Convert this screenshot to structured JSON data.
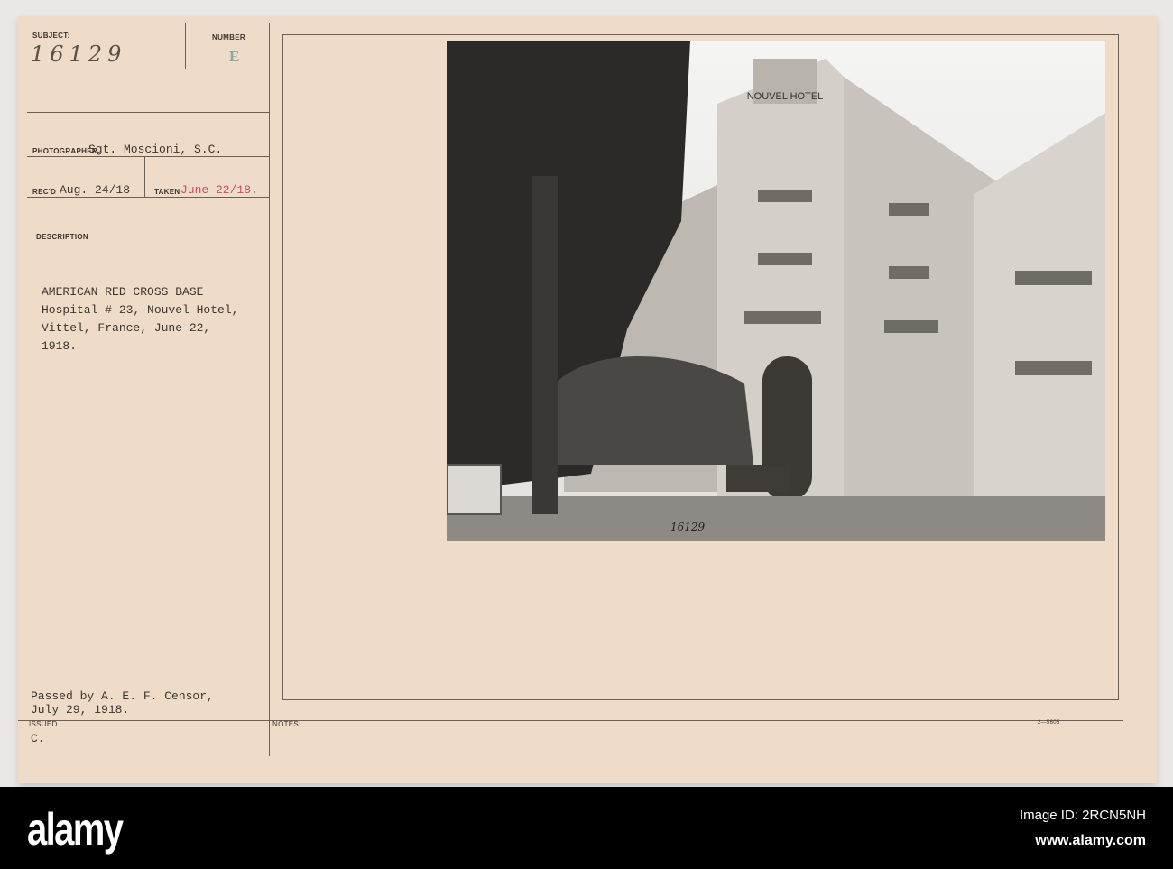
{
  "card": {
    "subject_label": "SUBJECT:",
    "subject_value": "16129",
    "number_label": "NUMBER",
    "number_value": "E",
    "photographer_label": "PHOTOGRAPHER",
    "photographer_value": "Sgt. Moscioni, S.C.",
    "recd_label": "REC'D",
    "recd_value": "Aug. 24/18",
    "taken_label": "TAKEN",
    "taken_value": "June 22/18.",
    "description_label": "DESCRIPTION",
    "description_lines": [
      "AMERICAN RED CROSS BASE",
      "Hospital # 23,  Nouvel Hotel,",
      "Vittel, France, June 22,",
      "1918."
    ],
    "censor_lines": [
      "Passed by A. E. F. Censor,",
      "July 29, 1918."
    ],
    "issued_label": "ISSUED",
    "issued_value": "C.",
    "notes_label": "NOTES:",
    "form_number": "2—5605",
    "photo_number": "16129",
    "hotel_sign": "NOUVEL HOTEL"
  },
  "footer": {
    "logo": "alamy",
    "image_id": "Image ID: 2RCN5NH",
    "url": "www.alamy.com"
  }
}
